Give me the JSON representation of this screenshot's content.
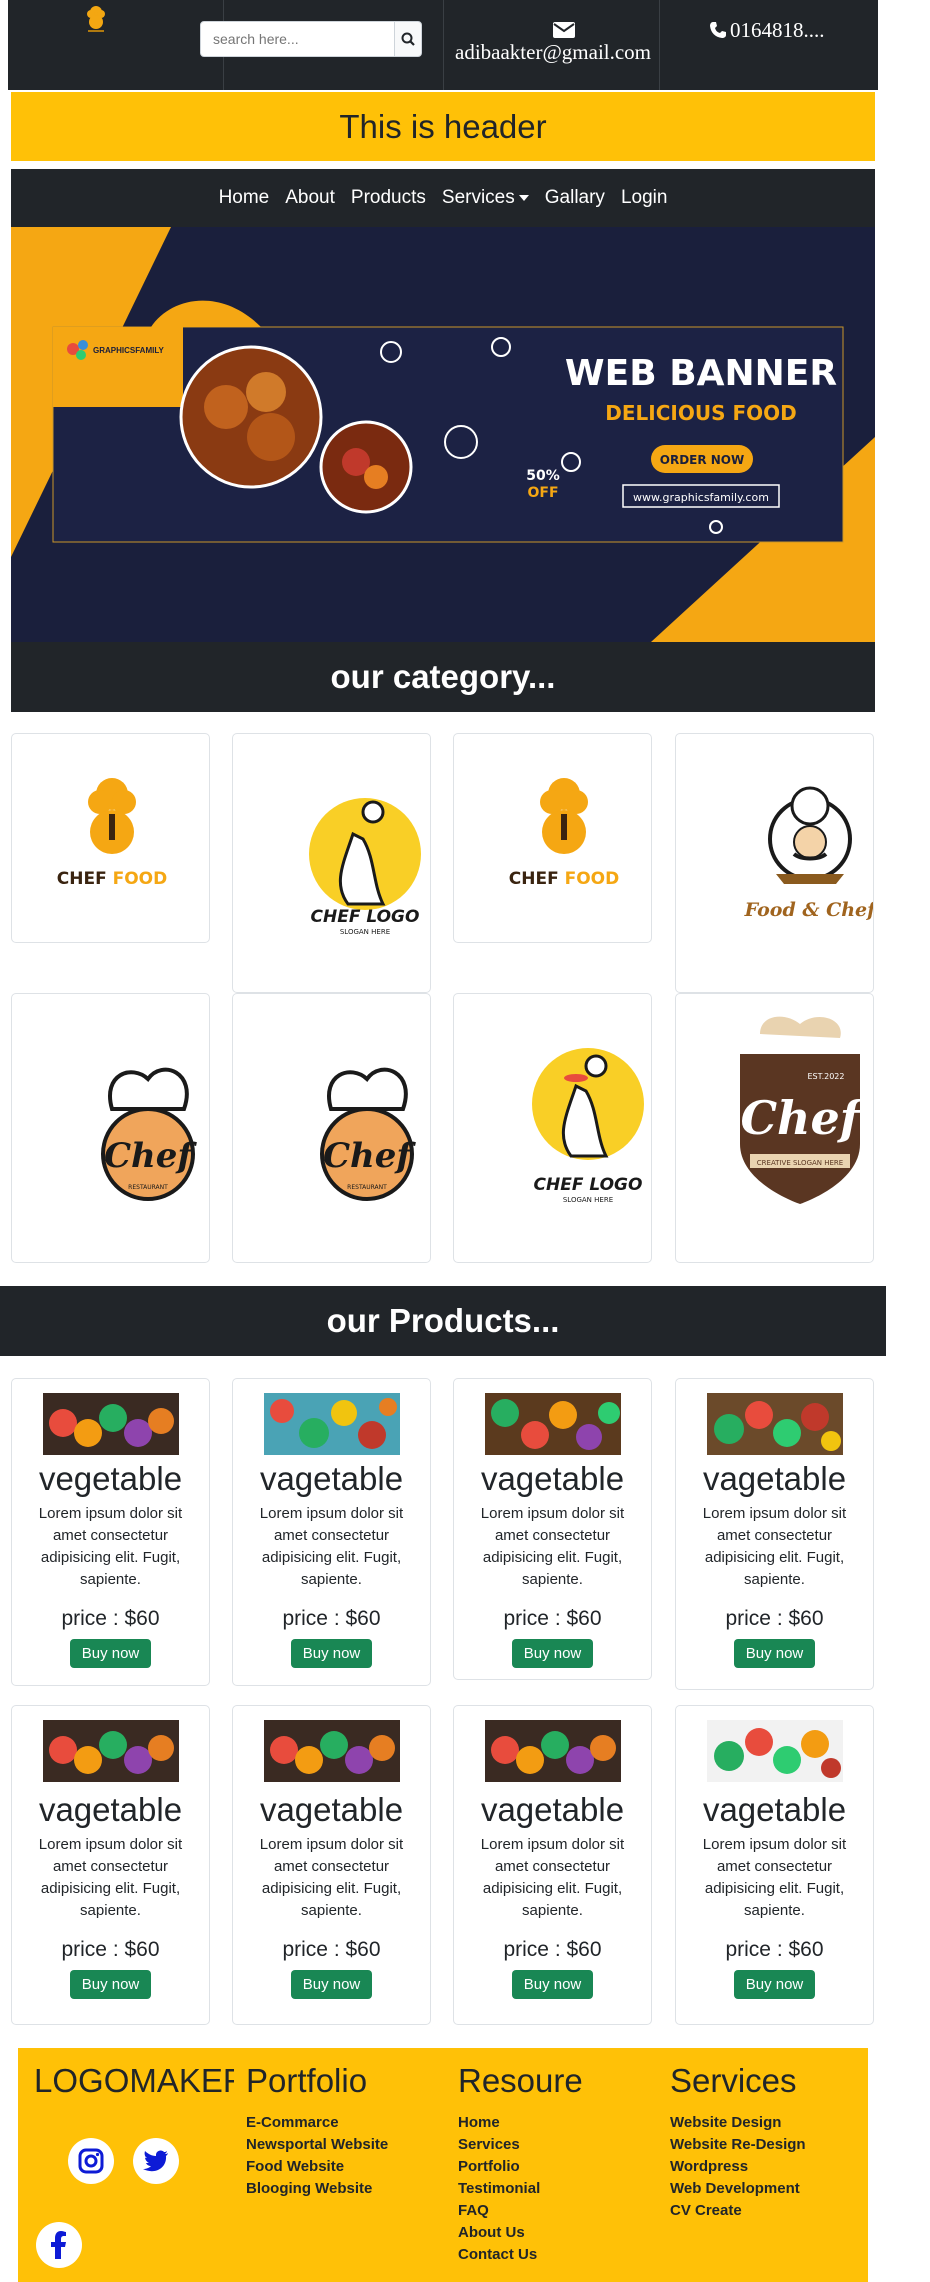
{
  "topbar": {
    "logo_icon": "chef-logo-icon",
    "search": {
      "placeholder": "search here...",
      "button_icon": "search-icon"
    },
    "email": {
      "icon": "envelope-icon",
      "text": "adibaakter@gmail.com"
    },
    "phone": {
      "icon": "phone-icon",
      "text": "0164818...."
    }
  },
  "header": {
    "title": "This is header"
  },
  "nav": {
    "items": [
      {
        "label": "Home"
      },
      {
        "label": "About"
      },
      {
        "label": "Products"
      },
      {
        "label": "Services"
      },
      {
        "label": "Gallary"
      },
      {
        "label": "Login"
      }
    ]
  },
  "banner": {
    "brand": "GRAPHICSFAMILY",
    "headline": "WEB BANNER",
    "subhead": "DELICIOUS FOOD",
    "cta": "ORDER NOW",
    "discount_pct": "50%",
    "discount_label": "OFF",
    "url": "www.graphicsfamily.com"
  },
  "categories": {
    "title": "our category...",
    "cards": [
      {
        "logo_top": "CHEF",
        "logo_bottom": "FOOD",
        "slogan": ""
      },
      {
        "logo_top": "CHEF LOGO",
        "logo_bottom": "",
        "slogan": "SLOGAN HERE"
      },
      {
        "logo_top": "CHEF",
        "logo_bottom": "FOOD",
        "slogan": ""
      },
      {
        "logo_top": "Food & Chef",
        "logo_bottom": "",
        "slogan": ""
      },
      {
        "logo_top": "Chef",
        "logo_bottom": "",
        "slogan": "RESTAURANT"
      },
      {
        "logo_top": "Chef",
        "logo_bottom": "",
        "slogan": "RESTAURANT"
      },
      {
        "logo_top": "CHEF LOGO",
        "logo_bottom": "",
        "slogan": "SLOGAN HERE"
      },
      {
        "logo_top": "Chef",
        "logo_bottom": "EST.2022",
        "slogan": "CREATIVE SLOGAN HERE"
      }
    ]
  },
  "products": {
    "title": "our Products...",
    "items": [
      {
        "name": "vegetable",
        "desc": "Lorem ipsum dolor sit amet consectetur adipisicing elit. Fugit, sapiente.",
        "price": "price : $60",
        "button": "Buy now"
      },
      {
        "name": "vagetable",
        "desc": "Lorem ipsum dolor sit amet consectetur adipisicing elit. Fugit, sapiente.",
        "price": "price : $60",
        "button": "Buy now"
      },
      {
        "name": "vagetable",
        "desc": "Lorem ipsum dolor sit amet consectetur adipisicing elit. Fugit, sapiente.",
        "price": "price : $60",
        "button": "Buy now"
      },
      {
        "name": "vagetable",
        "desc": "Lorem ipsum dolor sit amet consectetur adipisicing elit. Fugit, sapiente.",
        "price": "price : $60",
        "button": "Buy now"
      },
      {
        "name": "vagetable",
        "desc": "Lorem ipsum dolor sit amet consectetur adipisicing elit. Fugit, sapiente.",
        "price": "price : $60",
        "button": "Buy now"
      },
      {
        "name": "vagetable",
        "desc": "Lorem ipsum dolor sit amet consectetur adipisicing elit. Fugit, sapiente.",
        "price": "price : $60",
        "button": "Buy now"
      },
      {
        "name": "vagetable",
        "desc": "Lorem ipsum dolor sit amet consectetur adipisicing elit. Fugit, sapiente.",
        "price": "price : $60",
        "button": "Buy now"
      },
      {
        "name": "vagetable",
        "desc": "Lorem ipsum dolor sit amet consectetur adipisicing elit. Fugit, sapiente.",
        "price": "price : $60",
        "button": "Buy now"
      }
    ]
  },
  "footer": {
    "brand": "LOGOMAKER",
    "social": [
      "instagram-icon",
      "twitter-icon",
      "facebook-icon"
    ],
    "columns": [
      {
        "heading": "Portfolio",
        "links": [
          "E-Commarce",
          "Newsportal Website",
          "Food Website",
          "Blooging Website"
        ]
      },
      {
        "heading": "Resoure",
        "links": [
          "Home",
          "Services",
          "Portfolio",
          "Testimonial",
          "FAQ",
          "About Us",
          "Contact Us"
        ]
      },
      {
        "heading": "Services",
        "links": [
          "Website Design",
          "Website Re-Design",
          "Wordpress",
          "Web Development",
          "CV Create"
        ]
      }
    ]
  },
  "colors": {
    "dark": "#212529",
    "accent": "#ffc107",
    "button": "#198754",
    "navy": "#1a1f3c"
  }
}
